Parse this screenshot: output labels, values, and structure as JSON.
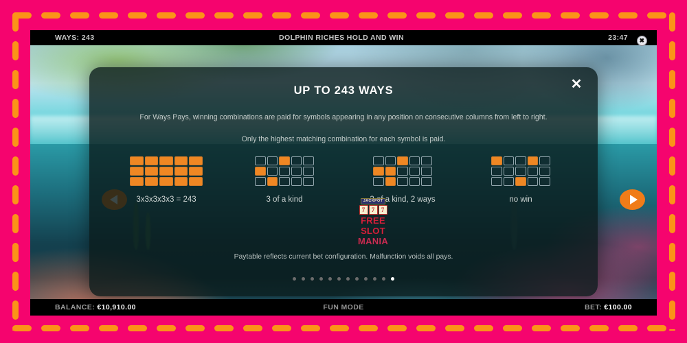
{
  "frame": {
    "border_color": "#f5046e",
    "dash_color": "#fb9318"
  },
  "game": {
    "topbar": {
      "ways": "WAYS: 243",
      "title": "DOLPHIN RICHES HOLD AND WIN",
      "clock": "23:47",
      "close_icon": "close-circle-icon",
      "close_glyph": "✖"
    },
    "bottombar": {
      "balance_label": "BALANCE:",
      "balance_value": "€10,910.00",
      "mode": "FUN MODE",
      "bet_label": "BET:",
      "bet_value": "€100.00"
    },
    "nav": {
      "prev_icon": "arrow-left-icon",
      "next_icon": "arrow-right-icon",
      "accent": "#f07c18"
    }
  },
  "modal": {
    "title": "UP TO 243 WAYS",
    "close_glyph": "✕",
    "paragraph_1": "For Ways Pays, winning combinations are paid for symbols appearing in any position on consecutive columns from left to right.",
    "paragraph_2": "Only the highest matching combination for each symbol is paid.",
    "footnote": "Paytable reflects current bet configuration. Malfunction voids all pays.",
    "cell_on_color": "#ef8723",
    "examples": [
      {
        "label": "3x3x3x3x3 = 243",
        "rows": 3,
        "cols": 5,
        "cells": [
          [
            1,
            1,
            1,
            1,
            1
          ],
          [
            1,
            1,
            1,
            1,
            1
          ],
          [
            1,
            1,
            1,
            1,
            1
          ]
        ]
      },
      {
        "label": "3 of a kind",
        "rows": 3,
        "cols": 5,
        "cells": [
          [
            0,
            0,
            1,
            0,
            0
          ],
          [
            1,
            0,
            0,
            0,
            0
          ],
          [
            0,
            1,
            0,
            0,
            0
          ]
        ]
      },
      {
        "label": "3 of a kind, 2 ways",
        "rows": 3,
        "cols": 5,
        "cells": [
          [
            0,
            0,
            1,
            0,
            0
          ],
          [
            1,
            1,
            0,
            0,
            0
          ],
          [
            0,
            1,
            0,
            0,
            0
          ]
        ]
      },
      {
        "label": "no win",
        "rows": 3,
        "cols": 5,
        "cells": [
          [
            1,
            0,
            0,
            1,
            0
          ],
          [
            0,
            0,
            0,
            0,
            0
          ],
          [
            0,
            0,
            1,
            0,
            0
          ]
        ]
      }
    ],
    "pagination": {
      "total": 12,
      "active_index": 11
    }
  },
  "watermark": {
    "jackpot": "JACKPOT",
    "reels": [
      "7",
      "7",
      "7"
    ],
    "line1": "FREE",
    "line2": "SLOT",
    "line3": "MANIA"
  }
}
